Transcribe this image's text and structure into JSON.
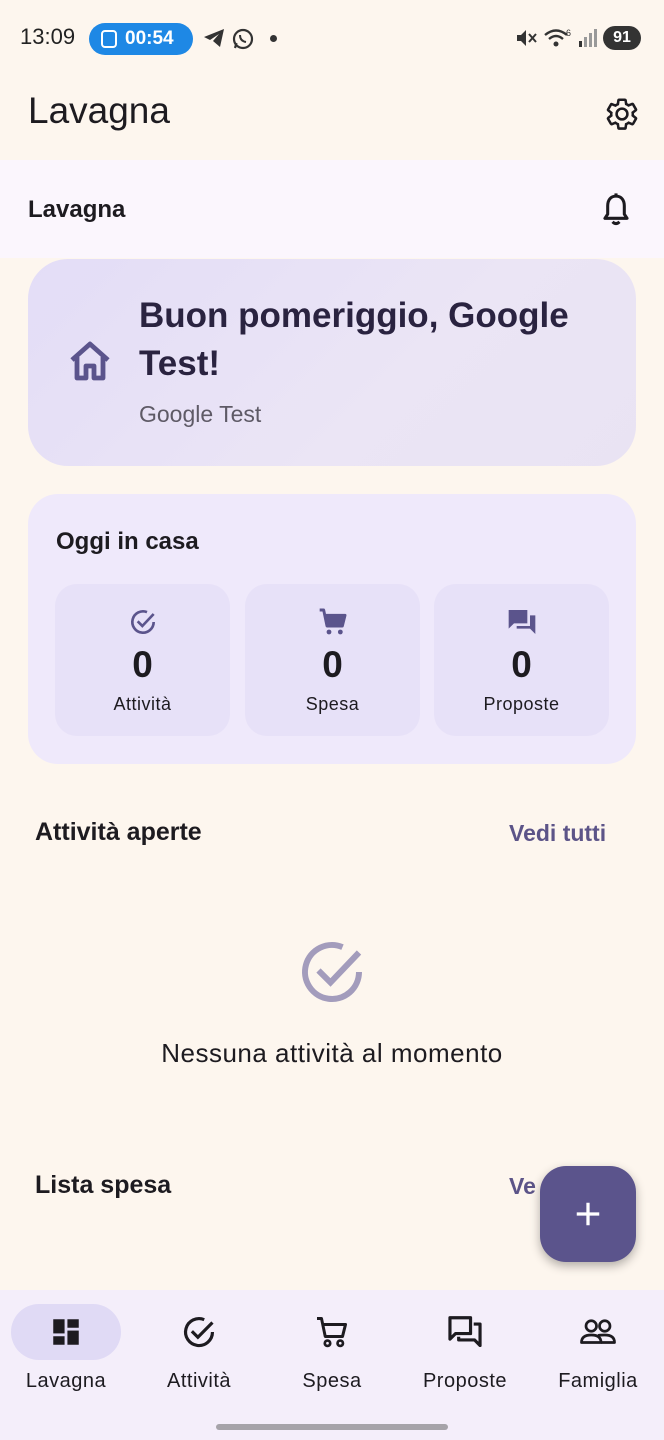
{
  "status_bar": {
    "time": "13:09",
    "timer": "00:54",
    "battery": "91"
  },
  "app_bar": {
    "title": "Lavagna"
  },
  "sub_bar": {
    "title": "Lavagna"
  },
  "greeting": {
    "headline": "Buon pomeriggio, Google Test!",
    "subtitle": "Google Test"
  },
  "today": {
    "title": "Oggi in casa",
    "stats": [
      {
        "icon": "check-circle-icon",
        "value": "0",
        "label": "Attività"
      },
      {
        "icon": "cart-icon",
        "value": "0",
        "label": "Spesa"
      },
      {
        "icon": "chat-icon",
        "value": "0",
        "label": "Proposte"
      }
    ]
  },
  "open_tasks": {
    "title": "Attività aperte",
    "link": "Vedi tutti",
    "empty_text": "Nessuna attività al momento"
  },
  "shopping": {
    "title": "Lista spesa",
    "link_visible": "Ve"
  },
  "nav": {
    "items": [
      {
        "label": "Lavagna",
        "icon": "dashboard-icon",
        "active": true
      },
      {
        "label": "Attività",
        "icon": "check-circle-icon",
        "active": false
      },
      {
        "label": "Spesa",
        "icon": "cart-icon",
        "active": false
      },
      {
        "label": "Proposte",
        "icon": "chat-icon",
        "active": false
      },
      {
        "label": "Famiglia",
        "icon": "people-icon",
        "active": false
      }
    ]
  },
  "colors": {
    "background": "#fdf6ee",
    "accent": "#5b548c",
    "card": "#efe9fb",
    "tile": "#e7e1f8"
  }
}
